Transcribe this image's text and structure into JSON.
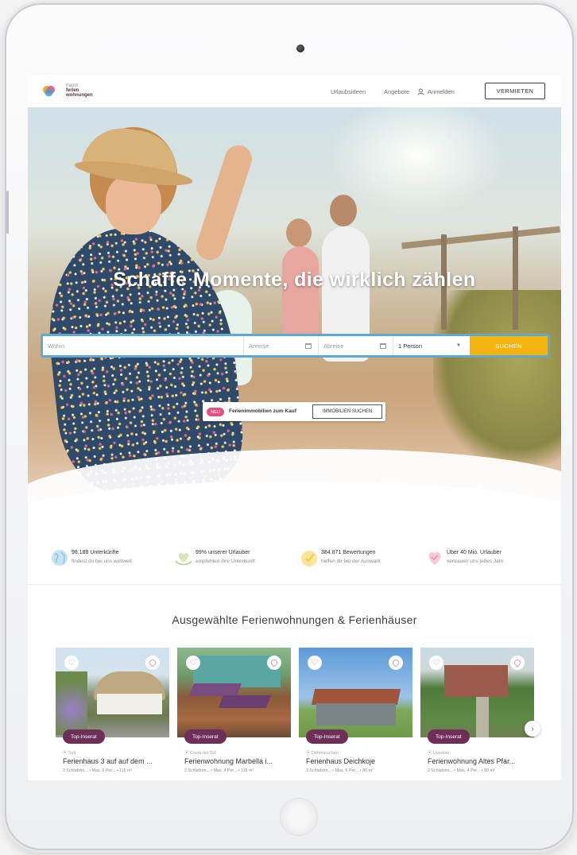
{
  "header": {
    "logo_lines": [
      "traum",
      "ferien",
      "wohnungen"
    ],
    "nav_ideas": "Urlaubsideen",
    "nav_offers": "Angebote",
    "nav_login": "Anmelden",
    "cta": "VERMIETEN"
  },
  "hero": {
    "title": "Schaffe Momente, die wirklich zählen"
  },
  "search": {
    "where_placeholder": "Wohin",
    "checkin": "Anreise",
    "checkout": "Abreise",
    "persons": "1 Person",
    "submit": "SUCHEN"
  },
  "promo": {
    "badge": "NEU",
    "text": "Ferienimmobilien zum Kauf",
    "button": "IMMOBILIEN SUCHEN"
  },
  "stats": [
    {
      "title": "98.188 Unterkünfte",
      "sub": "findest du bei uns weltweit",
      "icon": "globe-icon"
    },
    {
      "title": "99% unserer Urlauber",
      "sub": "empfehlen ihre Unterkunft",
      "icon": "heart-hands-icon"
    },
    {
      "title": "384.871 Bewertungen",
      "sub": "helfen dir bei der Auswahl",
      "icon": "rating-icon"
    },
    {
      "title": "Über 40 Mio. Urlauber",
      "sub": "vertrauen uns jedes Jahr",
      "icon": "heart-shield-icon"
    }
  ],
  "featured": {
    "title": "Ausgewählte Ferienwohnungen & Ferienhäuser",
    "cards": [
      {
        "badge": "Top-Inserat",
        "location": "Sylt",
        "title": "Ferienhaus 3 auf auf dem ...",
        "meta": "3 Schlafzim... • Max. 6 Per... • 115 m²"
      },
      {
        "badge": "Top-Inserat",
        "location": "Costa del Sol",
        "title": "Ferienwohnung Marbella i...",
        "meta": "2 Schlafzim... • Max. 4 Per... • 115 m²"
      },
      {
        "badge": "Top-Inserat",
        "location": "Dithmarschen",
        "title": "Ferienhaus Deichkoje",
        "meta": "3 Schlafzim... • Max. 6 Per... • 86 m²"
      },
      {
        "badge": "Top-Inserat",
        "location": "Usedom",
        "title": "Ferienwohnung Altes Pfar...",
        "meta": "2 Schlafzim... • Max. 4 Per... • 90 m²"
      }
    ]
  },
  "colors": {
    "brand_purple": "#6d2e57",
    "search_border": "#5fa7d4",
    "search_button": "#f5b40f",
    "badge_new": "#e2527e"
  }
}
